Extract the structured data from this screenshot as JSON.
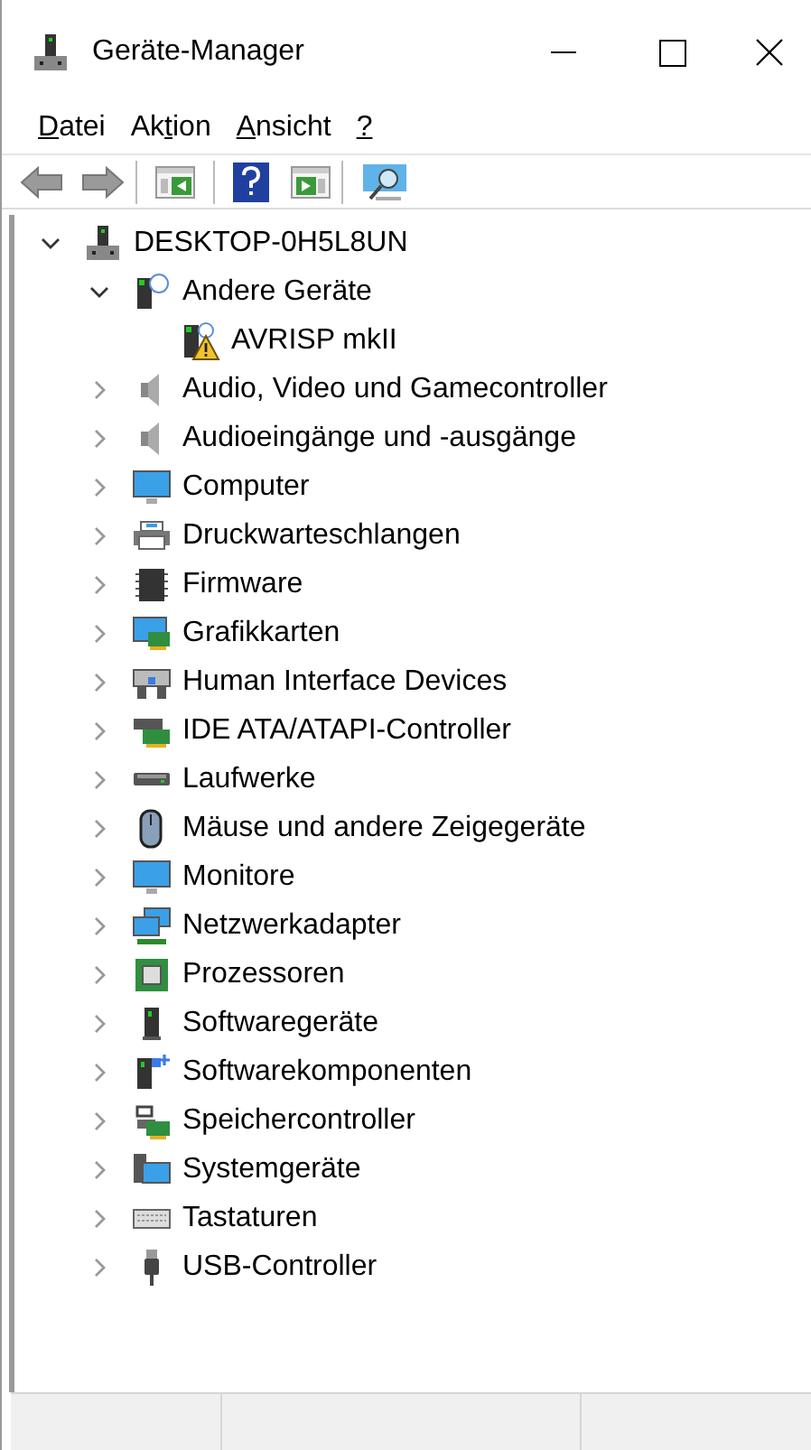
{
  "window": {
    "title": "Geräte-Manager"
  },
  "menu": [
    {
      "key": "D",
      "after": "atei"
    },
    {
      "before": "Ak",
      "key": "t",
      "after": "ion"
    },
    {
      "key": "A",
      "after": "nsicht"
    },
    {
      "key": "?"
    }
  ],
  "tree": [
    {
      "label": "DESKTOP-0H5L8UN",
      "expanded": true,
      "children": [
        {
          "label": "Andere Geräte",
          "expanded": true,
          "children": [
            {
              "label": "AVRISP mkII",
              "warning": true
            }
          ]
        },
        {
          "label": "Audio, Video und Gamecontroller",
          "expanded": false
        },
        {
          "label": "Audioeingänge und -ausgänge",
          "expanded": false
        },
        {
          "label": "Computer",
          "expanded": false
        },
        {
          "label": "Druckwarteschlangen",
          "expanded": false
        },
        {
          "label": "Firmware",
          "expanded": false
        },
        {
          "label": "Grafikkarten",
          "expanded": false
        },
        {
          "label": "Human Interface Devices",
          "expanded": false
        },
        {
          "label": "IDE ATA/ATAPI-Controller",
          "expanded": false
        },
        {
          "label": "Laufwerke",
          "expanded": false
        },
        {
          "label": "Mäuse und andere Zeigegeräte",
          "expanded": false
        },
        {
          "label": "Monitore",
          "expanded": false
        },
        {
          "label": "Netzwerkadapter",
          "expanded": false
        },
        {
          "label": "Prozessoren",
          "expanded": false
        },
        {
          "label": "Softwaregeräte",
          "expanded": false
        },
        {
          "label": "Softwarekomponenten",
          "expanded": false
        },
        {
          "label": "Speichercontroller",
          "expanded": false
        },
        {
          "label": "Systemgeräte",
          "expanded": false
        },
        {
          "label": "Tastaturen",
          "expanded": false
        },
        {
          "label": "USB-Controller",
          "expanded": false
        }
      ]
    }
  ]
}
